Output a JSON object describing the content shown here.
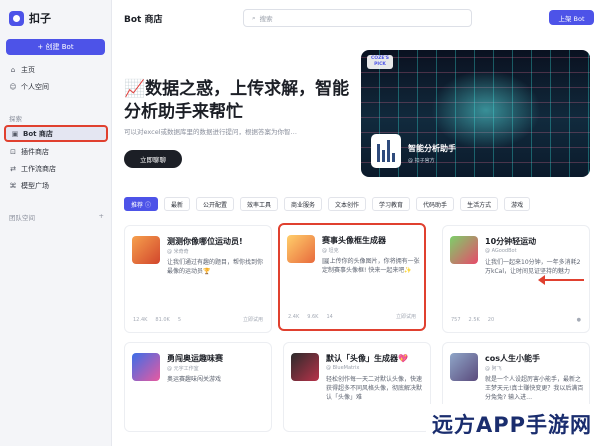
{
  "app": {
    "name": "扣子"
  },
  "sidebar": {
    "create_label": "+ 创建 Bot",
    "nav_top": [
      {
        "icon": "⌂",
        "label": "主页"
      },
      {
        "icon": "☺",
        "label": "个人空间"
      }
    ],
    "section_label": "探索",
    "nav_explore": [
      {
        "icon": "▣",
        "label": "Bot 商店"
      },
      {
        "icon": "⊡",
        "label": "插件商店"
      },
      {
        "icon": "⇄",
        "label": "工作流商店"
      },
      {
        "icon": "⌘",
        "label": "模型广场"
      }
    ],
    "team_label": "团队空间",
    "team_add": "+"
  },
  "header": {
    "title": "Bot 商店",
    "search_placeholder": "搜索",
    "publish_label": "上架 Bot"
  },
  "hero": {
    "title": "📈数据之惑，上传求解，智能分析助手来帮忙",
    "subtitle": "可以对excel或数据库里的数据进行提问，根据答案为你智…",
    "button": "立即聊聊",
    "badge": "COZE'S PICK",
    "card_title": "智能分析助手",
    "card_author": "@ 扣子官方"
  },
  "tabs": [
    "推荐",
    "最新",
    "公开配置",
    "效率工具",
    "商业服务",
    "文本创作",
    "学习教育",
    "代码助手",
    "生活方式",
    "游戏"
  ],
  "cards": [
    {
      "name": "测测你像哪位运动员!",
      "author": "@ 米奇奇",
      "desc": "让我们通过有趣的题目，帮你找到你最像的运动员🏆",
      "stats": [
        "12.4K",
        "81.0K",
        "5"
      ],
      "right": "立即试用"
    },
    {
      "name": "赛事头像框生成器",
      "author": "@ 坦克",
      "desc": "🖼上传你的头像图片，你将拥有一张定制赛事头像框! 快来一起来吧✨",
      "stats": [
        "2.4K",
        "9.6K",
        "14"
      ],
      "right": "立即试用"
    },
    {
      "name": "10分钟轻运动",
      "author": "@ AGoodBot",
      "desc": "让我们一起来10分钟，一年多消耗2万kCal，让时间见证坚持的魅力",
      "stats": [
        "757",
        "2.5K",
        "20"
      ],
      "right": ""
    },
    {
      "name": "勇闯奥运趣味赛",
      "author": "@ 元宇工作室",
      "desc": "奥运赛趣味闯关游戏",
      "stats": [],
      "right": ""
    },
    {
      "name": "默认「头像」生成器💖",
      "author": "@ BlueMatrix",
      "desc": "轻松创作每一天二对默认头像，快速获得超多不同风格头像，彻底解决默认「头像」难",
      "stats": [],
      "right": ""
    },
    {
      "name": "cos人生小能手",
      "author": "@ 阿飞",
      "desc": "就是一个人设超厉害小能手，最新之王梦天元!真士赚快变更？我以后满百分兔兔? 输入进…",
      "stats": [],
      "right": ""
    }
  ],
  "watermark": "远方APP手游网",
  "colors": {
    "accent": "#4d53e8",
    "highlight": "#e0402f"
  }
}
